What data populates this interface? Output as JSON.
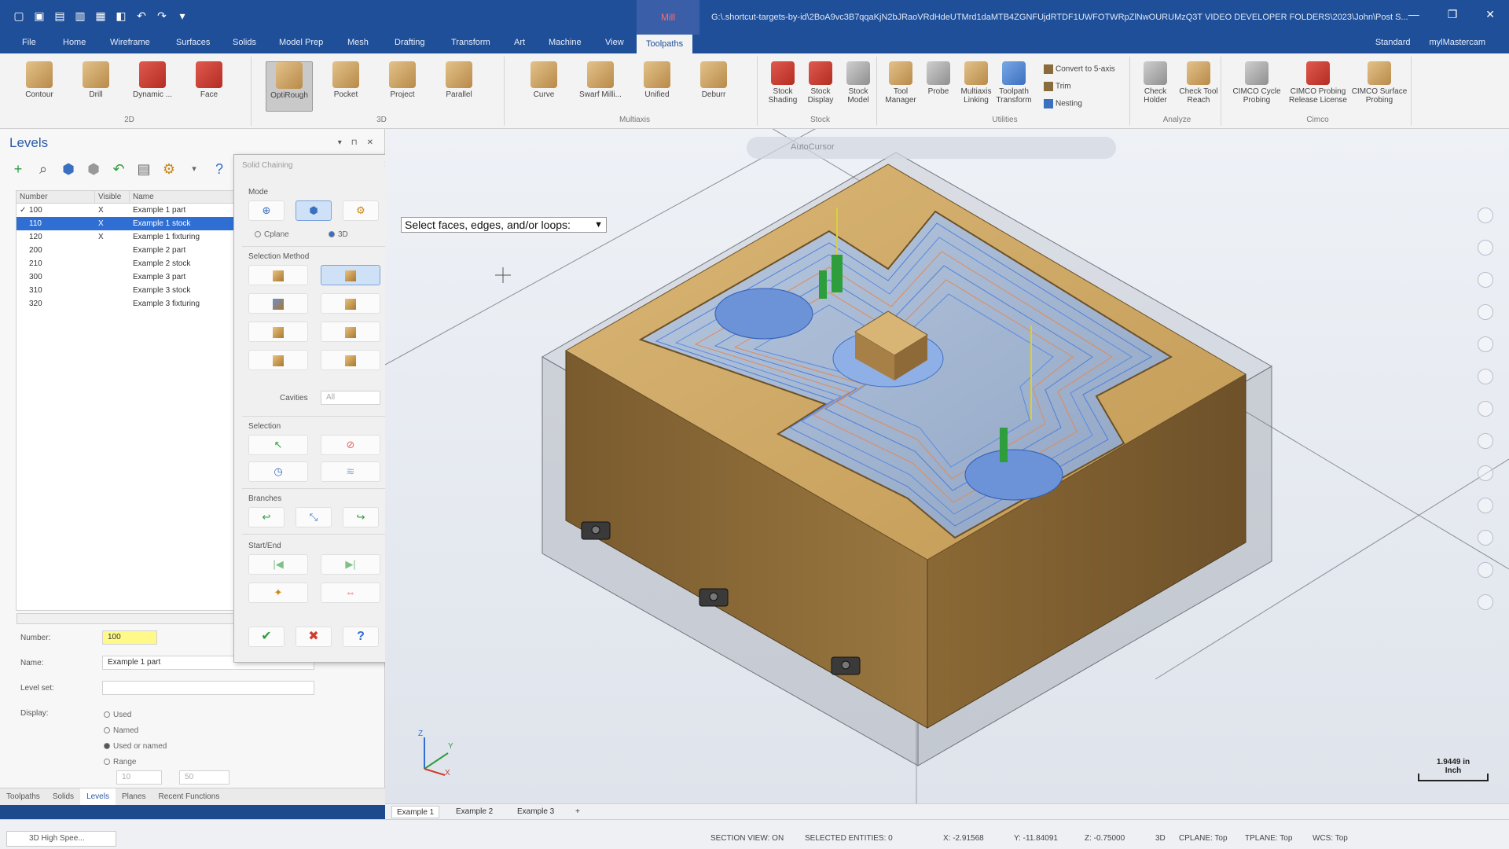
{
  "titlebar": {
    "context_tab": "Mill",
    "path": "G:\\.shortcut-targets-by-id\\2BoA9vc3B7qqaKjN2bJRaoVRdHdeUTMrd1daMTB4ZGNFUjdRTDF1UWFOTWRpZlNwOURUMzQ3T VIDEO DEVELOPER FOLDERS\\2023\\John\\Post S...",
    "controls": [
      "—",
      "❐",
      "✕"
    ]
  },
  "menu": {
    "items": [
      "File",
      "Home",
      "Wireframe",
      "Surfaces",
      "Solids",
      "Model Prep",
      "Mesh",
      "Drafting",
      "Transform",
      "Art",
      "Machine",
      "View",
      "Toolpaths"
    ],
    "active": "Toolpaths",
    "right": [
      "Standard",
      "mylMastercam"
    ]
  },
  "ribbon": {
    "groups": [
      {
        "label": "2D",
        "buttons": [
          "Contour",
          "Drill",
          "Dynamic ...",
          "Face"
        ]
      },
      {
        "label": "3D",
        "buttons": [
          "OptiRough",
          "Pocket",
          "Project",
          "Parallel"
        ]
      },
      {
        "label": "Multiaxis",
        "buttons": [
          "Curve",
          "Swarf Milli...",
          "Unified",
          "Deburr"
        ]
      },
      {
        "label": "Stock",
        "buttons": [
          "Stock Shading",
          "Stock Display",
          "Stock Model"
        ]
      },
      {
        "label": "Utilities",
        "buttons": [
          "Tool Manager",
          "Probe",
          "Multiaxis Linking",
          "Toolpath Transform"
        ],
        "small": [
          "Convert to 5-axis",
          "Trim",
          "Nesting"
        ]
      },
      {
        "label": "Analyze",
        "buttons": [
          "Check Holder",
          "Check Tool Reach"
        ]
      },
      {
        "label": "Cimco",
        "buttons": [
          "CIMCO Cycle Probing",
          "CIMCO Probing Release License",
          "CIMCO Surface Probing"
        ]
      }
    ]
  },
  "levels": {
    "title": "Levels",
    "panel_controls": [
      "▾",
      "⊓",
      "✕"
    ],
    "columns": [
      "Number",
      "Visible",
      "Name"
    ],
    "rows": [
      {
        "check": "✓",
        "number": "100",
        "visible": "X",
        "name": "Example 1 part"
      },
      {
        "check": "",
        "number": "110",
        "visible": "X",
        "name": "Example 1 stock"
      },
      {
        "check": "",
        "number": "120",
        "visible": "X",
        "name": "Example 1 fixturing"
      },
      {
        "check": "",
        "number": "200",
        "visible": "",
        "name": "Example 2 part"
      },
      {
        "check": "",
        "number": "210",
        "visible": "",
        "name": "Example 2 stock"
      },
      {
        "check": "",
        "number": "300",
        "visible": "",
        "name": "Example 3 part"
      },
      {
        "check": "",
        "number": "310",
        "visible": "",
        "name": "Example 3 stock"
      },
      {
        "check": "",
        "number": "320",
        "visible": "",
        "name": "Example 3 fixturing"
      }
    ],
    "selected_row": 1,
    "props": {
      "number_label": "Number:",
      "number_value": "100",
      "name_label": "Name:",
      "name_value": "Example 1 part",
      "levelset_label": "Level set:",
      "levelset_value": "",
      "display_label": "Display:",
      "display_options": [
        "Used",
        "Named",
        "Used or named",
        "Range"
      ],
      "display_selected": 2,
      "range_from": "10",
      "range_to": "50"
    },
    "bottom_tabs": [
      "Toolpaths",
      "Solids",
      "Levels",
      "Planes",
      "Recent Functions"
    ],
    "active_tab": "Levels"
  },
  "chain": {
    "title": "Solid Chaining",
    "close": "✕",
    "mode_label": "Mode",
    "cplane_label": "Cplane",
    "threed_label": "3D",
    "selection_method_label": "Selection Method",
    "cavities_label": "Cavities",
    "cavities_value": "All",
    "selection_label": "Selection",
    "branches_label": "Branches",
    "startend_label": "Start/End"
  },
  "viewport": {
    "prompt": "Select faces, edges, and/or loops:",
    "autocursor": "AutoCursor",
    "scale": "1.9449 in",
    "scale_unit": "Inch",
    "axis_labels": [
      "Z",
      "Y",
      "X"
    ]
  },
  "view_tabs": {
    "items": [
      "Example 1",
      "Example 2",
      "Example 3"
    ],
    "active": "Example 1"
  },
  "status": {
    "task": "3D High Spee...",
    "section_view": "SECTION VIEW: ON",
    "selected": "SELECTED ENTITIES: 0",
    "x": "X: -2.91568",
    "y": "Y: -11.84091",
    "z": "Z: -0.75000",
    "mode": "3D",
    "cplane": "CPLANE: Top",
    "tplane": "TPLANE: Top",
    "wcs": "WCS: Top"
  },
  "colors": {
    "accent": "#1f4f99",
    "selection": "#2f6fd3",
    "part": "#c9a15e"
  }
}
